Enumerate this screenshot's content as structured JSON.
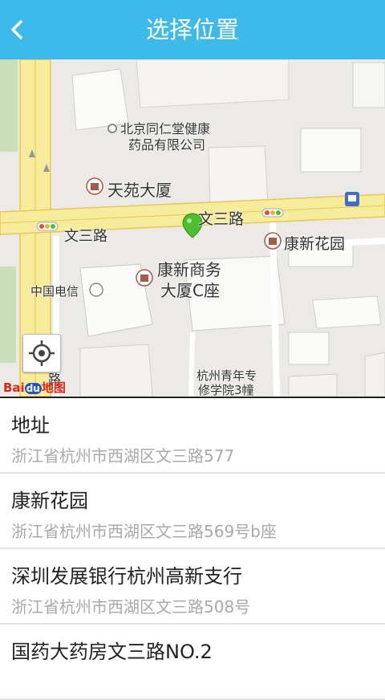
{
  "header": {
    "title": "选择位置",
    "back_icon": "chevron-left-icon"
  },
  "map": {
    "labels": {
      "tongrentang": "北京同仁堂健康",
      "tongrentang2": "药品有限公司",
      "tianyuan": "天苑大厦",
      "wensanlu_right": "文三路",
      "wensanlu_left": "文三路",
      "kangxin_huayuan": "康新花园",
      "kangxin_shangwu": "康新商务",
      "kangxin_shangwu2": "大厦C座",
      "zhongguo_dianxin": "中国电信",
      "qingnian": "杭州青年专",
      "qingnian2": "修学院3幢",
      "lu_partial": "路"
    },
    "logo_text": "Bai",
    "logo_du": "du",
    "logo_tail": "地图",
    "locate_icon": "locate-icon",
    "marker_icon": "map-pin-icon"
  },
  "places": [
    {
      "name": "地址",
      "address": "浙江省杭州市西湖区文三路577"
    },
    {
      "name": "康新花园",
      "address": "浙江省杭州市西湖区文三路569号b座"
    },
    {
      "name": "深圳发展银行杭州高新支行",
      "address": "浙江省杭州市西湖区文三路508号"
    },
    {
      "name": "国药大药房文三路NO.2",
      "address": ""
    }
  ],
  "colors": {
    "header": "#3db9ea",
    "road": "#f7ec9c",
    "road_edge": "#e6c85a",
    "marker": "#4cbf2e"
  }
}
